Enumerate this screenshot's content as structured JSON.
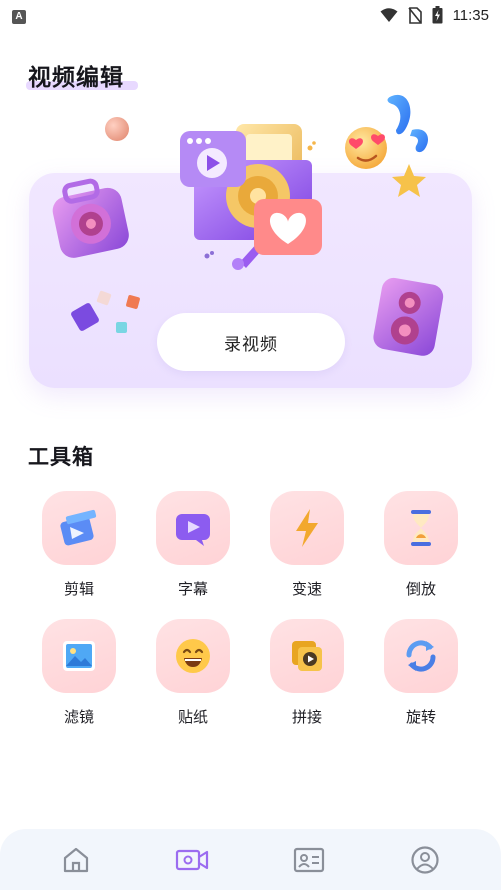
{
  "status_bar": {
    "left_badge": "A",
    "time": "11:35",
    "icons": [
      "wifi-icon",
      "no-sim-icon",
      "battery-charging-icon"
    ]
  },
  "video_edit": {
    "title": "视频编辑",
    "record_button_label": "录视频"
  },
  "toolbox": {
    "title": "工具箱",
    "tools": [
      {
        "label": "剪辑",
        "icon": "clapperboard-icon"
      },
      {
        "label": "字幕",
        "icon": "subtitle-play-icon"
      },
      {
        "label": "变速",
        "icon": "lightning-icon"
      },
      {
        "label": "倒放",
        "icon": "hourglass-icon"
      },
      {
        "label": "滤镜",
        "icon": "landscape-picture-icon"
      },
      {
        "label": "贴纸",
        "icon": "smile-emoji-icon"
      },
      {
        "label": "拼接",
        "icon": "stacked-video-icon"
      },
      {
        "label": "旋转",
        "icon": "rotate-arrows-icon"
      }
    ]
  },
  "bottom_nav": {
    "items": [
      {
        "icon": "home-icon",
        "active": false
      },
      {
        "icon": "video-camera-icon",
        "active": true
      },
      {
        "icon": "id-card-icon",
        "active": false
      },
      {
        "icon": "user-profile-icon",
        "active": false
      }
    ]
  },
  "colors": {
    "accent": "#9b6cf0",
    "hero_bg": "#efe5ff",
    "tool_bg": "#ffd9dc",
    "nav_bg": "#f2f6fc",
    "nav_icon": "#8a8f99"
  }
}
